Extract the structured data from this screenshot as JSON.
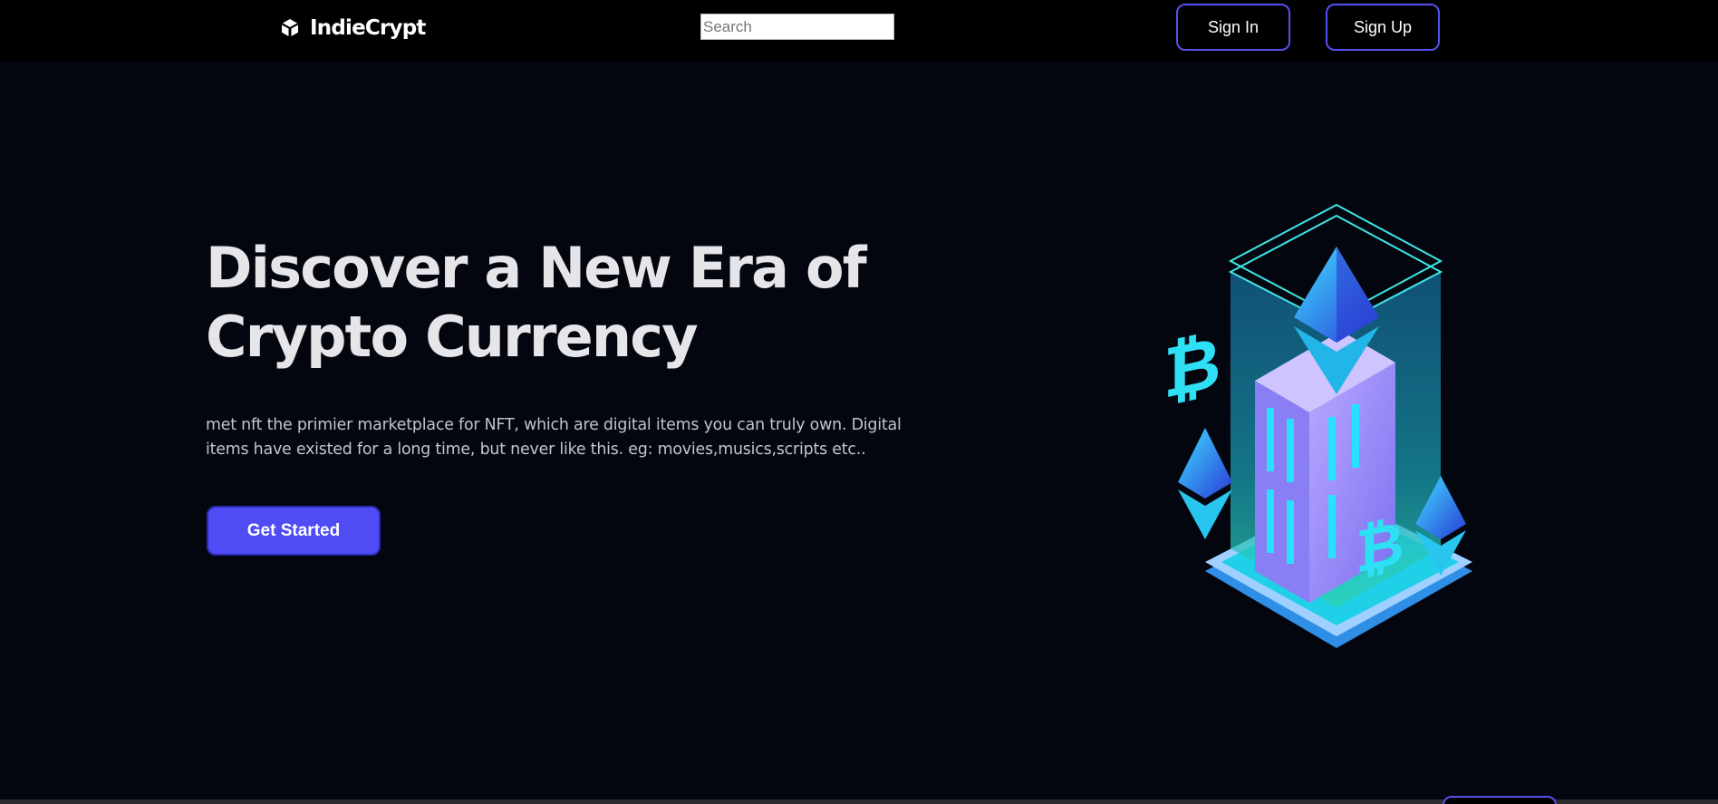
{
  "nav": {
    "brand": "IndieCrypt",
    "search_placeholder": "Search",
    "signin_label": "Sign In",
    "signup_label": "Sign Up"
  },
  "hero": {
    "title_line1": "Discover a New Era of",
    "title_line2": "Crypto Currency",
    "description": "met nft the primier marketplace for NFT, which are digital items you can truly own. Digital items have existed for a long time, but never like this. eg: movies,musics,scripts etc..",
    "cta_label": "Get Started"
  },
  "colors": {
    "background": "#04060f",
    "navbar": "#000000",
    "accent": "#4f4cf5",
    "button_border": "#5550f0",
    "title_text": "#e6e6ea"
  },
  "icons": {
    "brand": "blockchain-logo-icon",
    "illustration": "crypto-building-illustration"
  }
}
